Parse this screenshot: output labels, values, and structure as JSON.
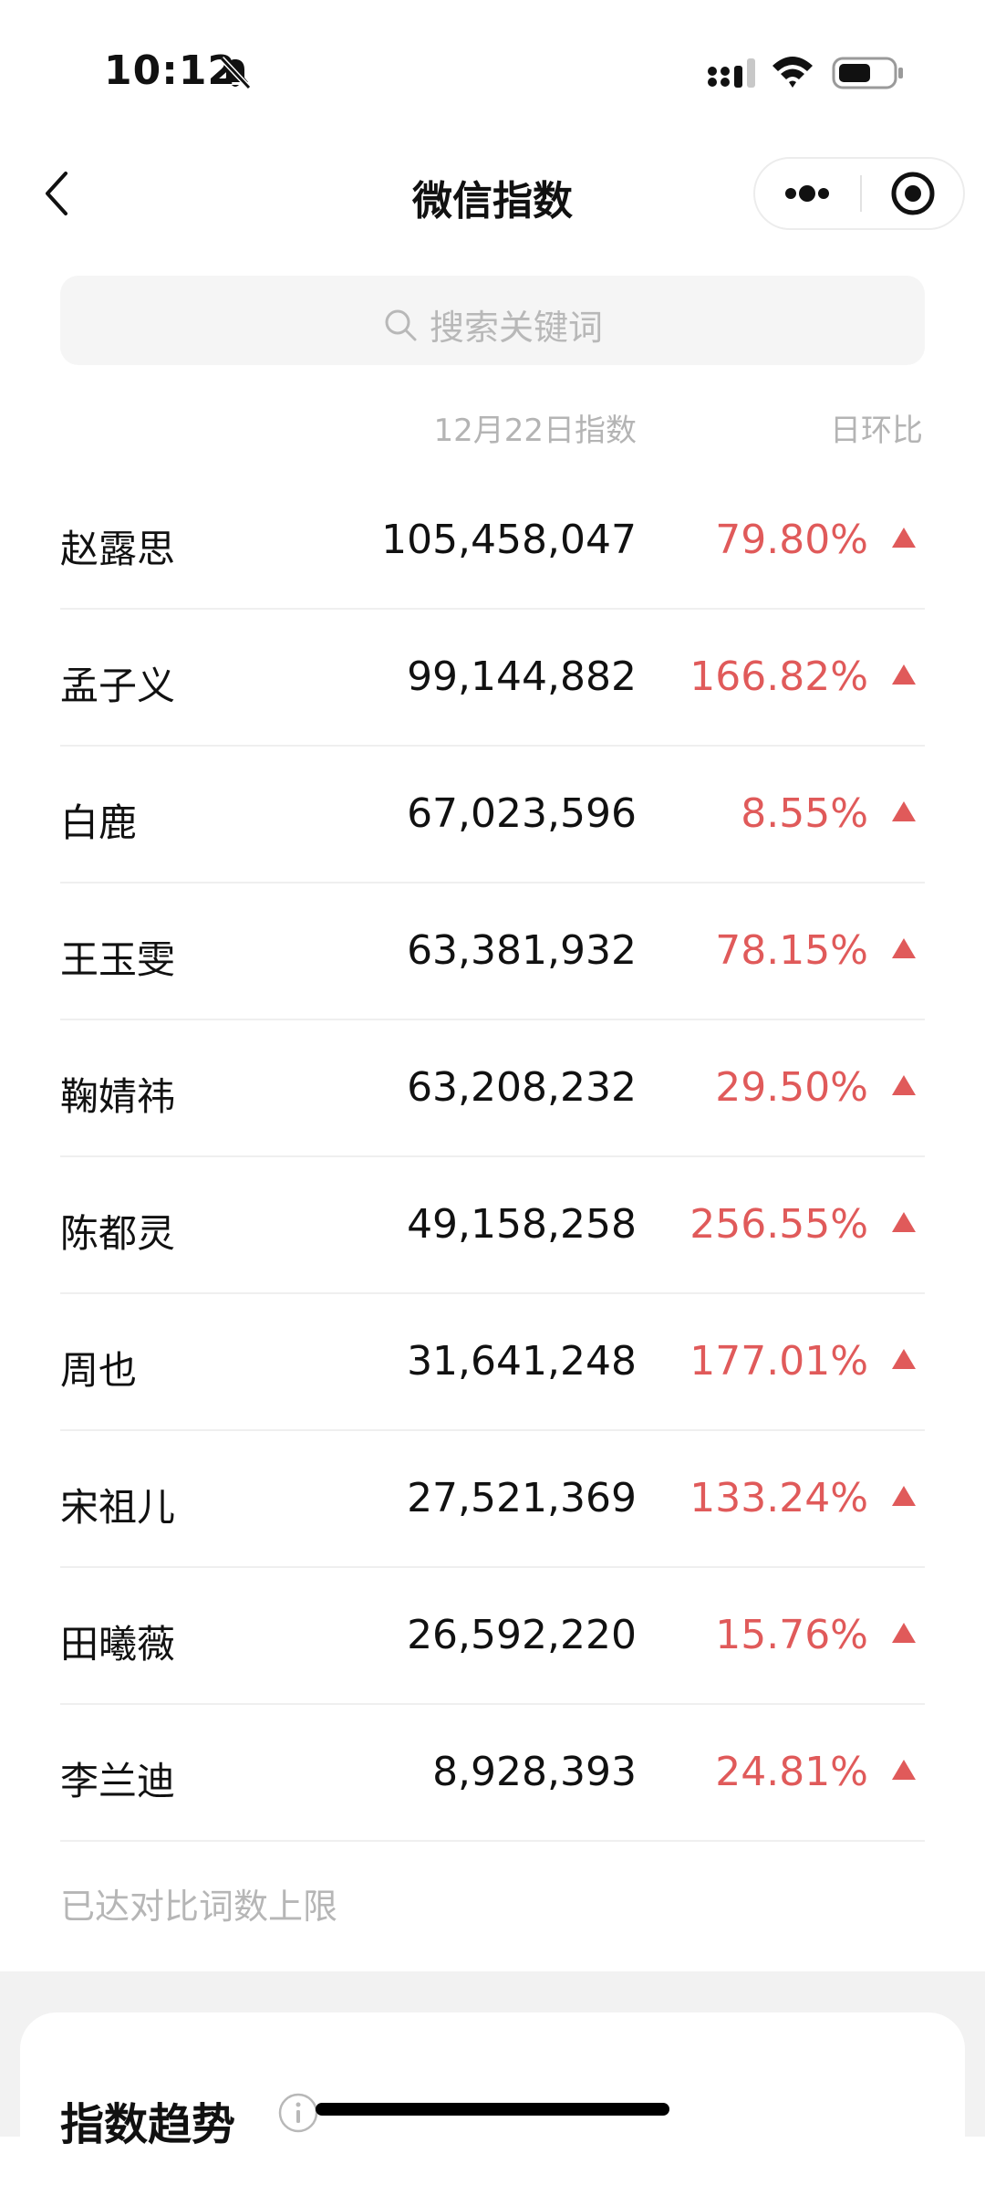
{
  "status_bar": {
    "time": "10:12"
  },
  "nav": {
    "title": "微信指数"
  },
  "search": {
    "placeholder": "搜索关键词"
  },
  "table": {
    "date_header": "12月22日指数",
    "ratio_header": "日环比",
    "rows": [
      {
        "name": "赵露思",
        "value": "105,458,047",
        "ratio": "79.80%",
        "trend": "up"
      },
      {
        "name": "孟子义",
        "value": "99,144,882",
        "ratio": "166.82%",
        "trend": "up"
      },
      {
        "name": "白鹿",
        "value": "67,023,596",
        "ratio": "8.55%",
        "trend": "up"
      },
      {
        "name": "王玉雯",
        "value": "63,381,932",
        "ratio": "78.15%",
        "trend": "up"
      },
      {
        "name": "鞠婧祎",
        "value": "63,208,232",
        "ratio": "29.50%",
        "trend": "up"
      },
      {
        "name": "陈都灵",
        "value": "49,158,258",
        "ratio": "256.55%",
        "trend": "up"
      },
      {
        "name": "周也",
        "value": "31,641,248",
        "ratio": "177.01%",
        "trend": "up"
      },
      {
        "name": "宋祖儿",
        "value": "27,521,369",
        "ratio": "133.24%",
        "trend": "up"
      },
      {
        "name": "田曦薇",
        "value": "26,592,220",
        "ratio": "15.76%",
        "trend": "up"
      },
      {
        "name": "李兰迪",
        "value": "8,928,393",
        "ratio": "24.81%",
        "trend": "up"
      }
    ],
    "limit_note": "已达对比词数上限"
  },
  "trend_card": {
    "title": "指数趋势"
  },
  "colors": {
    "up": "#e05a5a",
    "muted_text": "#b4b4b4",
    "search_bg": "#f5f5f5"
  }
}
